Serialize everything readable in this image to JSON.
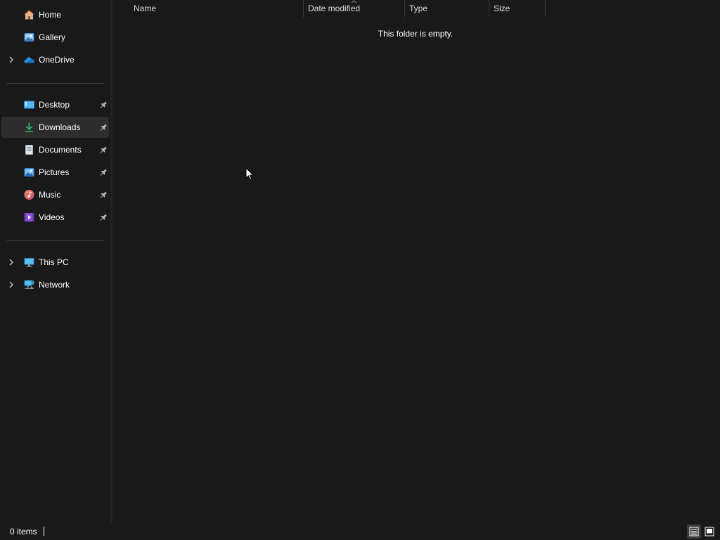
{
  "sidebar": {
    "top_items": [
      {
        "label": "Home",
        "icon": "home-icon"
      },
      {
        "label": "Gallery",
        "icon": "gallery-icon"
      },
      {
        "label": "OneDrive",
        "icon": "onedrive-icon",
        "expandable": true
      }
    ],
    "quick_access": [
      {
        "label": "Desktop",
        "icon": "desktop-folder-icon",
        "pinned": true
      },
      {
        "label": "Downloads",
        "icon": "downloads-folder-icon",
        "pinned": true,
        "selected": true
      },
      {
        "label": "Documents",
        "icon": "documents-folder-icon",
        "pinned": true
      },
      {
        "label": "Pictures",
        "icon": "pictures-folder-icon",
        "pinned": true
      },
      {
        "label": "Music",
        "icon": "music-folder-icon",
        "pinned": true
      },
      {
        "label": "Videos",
        "icon": "videos-folder-icon",
        "pinned": true
      }
    ],
    "locations": [
      {
        "label": "This PC",
        "icon": "this-pc-icon",
        "expandable": true
      },
      {
        "label": "Network",
        "icon": "network-icon",
        "expandable": true
      }
    ]
  },
  "columns": {
    "name": "Name",
    "date_modified": "Date modified",
    "type": "Type",
    "size": "Size"
  },
  "content": {
    "empty_message": "This folder is empty."
  },
  "statusbar": {
    "item_count": "0 items",
    "views": [
      {
        "name": "details-view-icon",
        "active": true
      },
      {
        "name": "large-icons-view-icon",
        "active": false
      }
    ]
  },
  "colors": {
    "background": "#191919",
    "selected_item": "#2d2d2d",
    "divider": "#3a3a3a",
    "text": "#ffffff"
  }
}
